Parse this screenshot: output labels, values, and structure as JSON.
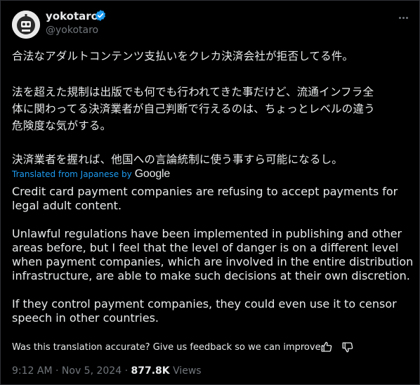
{
  "author": {
    "name": "yokotaro",
    "handle": "@yokotaro",
    "verified": true,
    "avatar_icon": "robot-face-icon"
  },
  "original_text": [
    "合法なアダルトコンテンツ支払いをクレカ決済会社が拒否してる件。",
    "法を超えた規制は出版でも何でも行われてきた事だけど、流通インフラ全",
    "体に関わってる決済業者が自己判断で行えるのは、ちょっとレベルの違う",
    "危険度な気がする。",
    "決済業者を握れば、他国への言論統制に使う事すら可能になるし。"
  ],
  "translation": {
    "label": "Translated from Japanese by",
    "provider": "Google",
    "lines": [
      "Credit card payment companies are refusing to accept payments for",
      "legal adult content.",
      "Unlawful regulations have been implemented in publishing and other",
      "areas before, but I feel that the level of danger is on a different level",
      "when payment companies, which are involved in the entire distribution",
      "infrastructure, are able to make such decisions at their own discretion.",
      "If they control payment companies, they could even use it to censor",
      "speech in other countries."
    ],
    "feedback_prompt": "Was this translation accurate? Give us feedback so we can improve:"
  },
  "meta": {
    "time": "9:12 AM",
    "date": "Nov 5, 2024",
    "views_count": "877.8K",
    "views_label": "Views"
  },
  "colors": {
    "background": "#000000",
    "text": "#e7e9ea",
    "muted": "#71767b",
    "link": "#1d9bf0"
  }
}
